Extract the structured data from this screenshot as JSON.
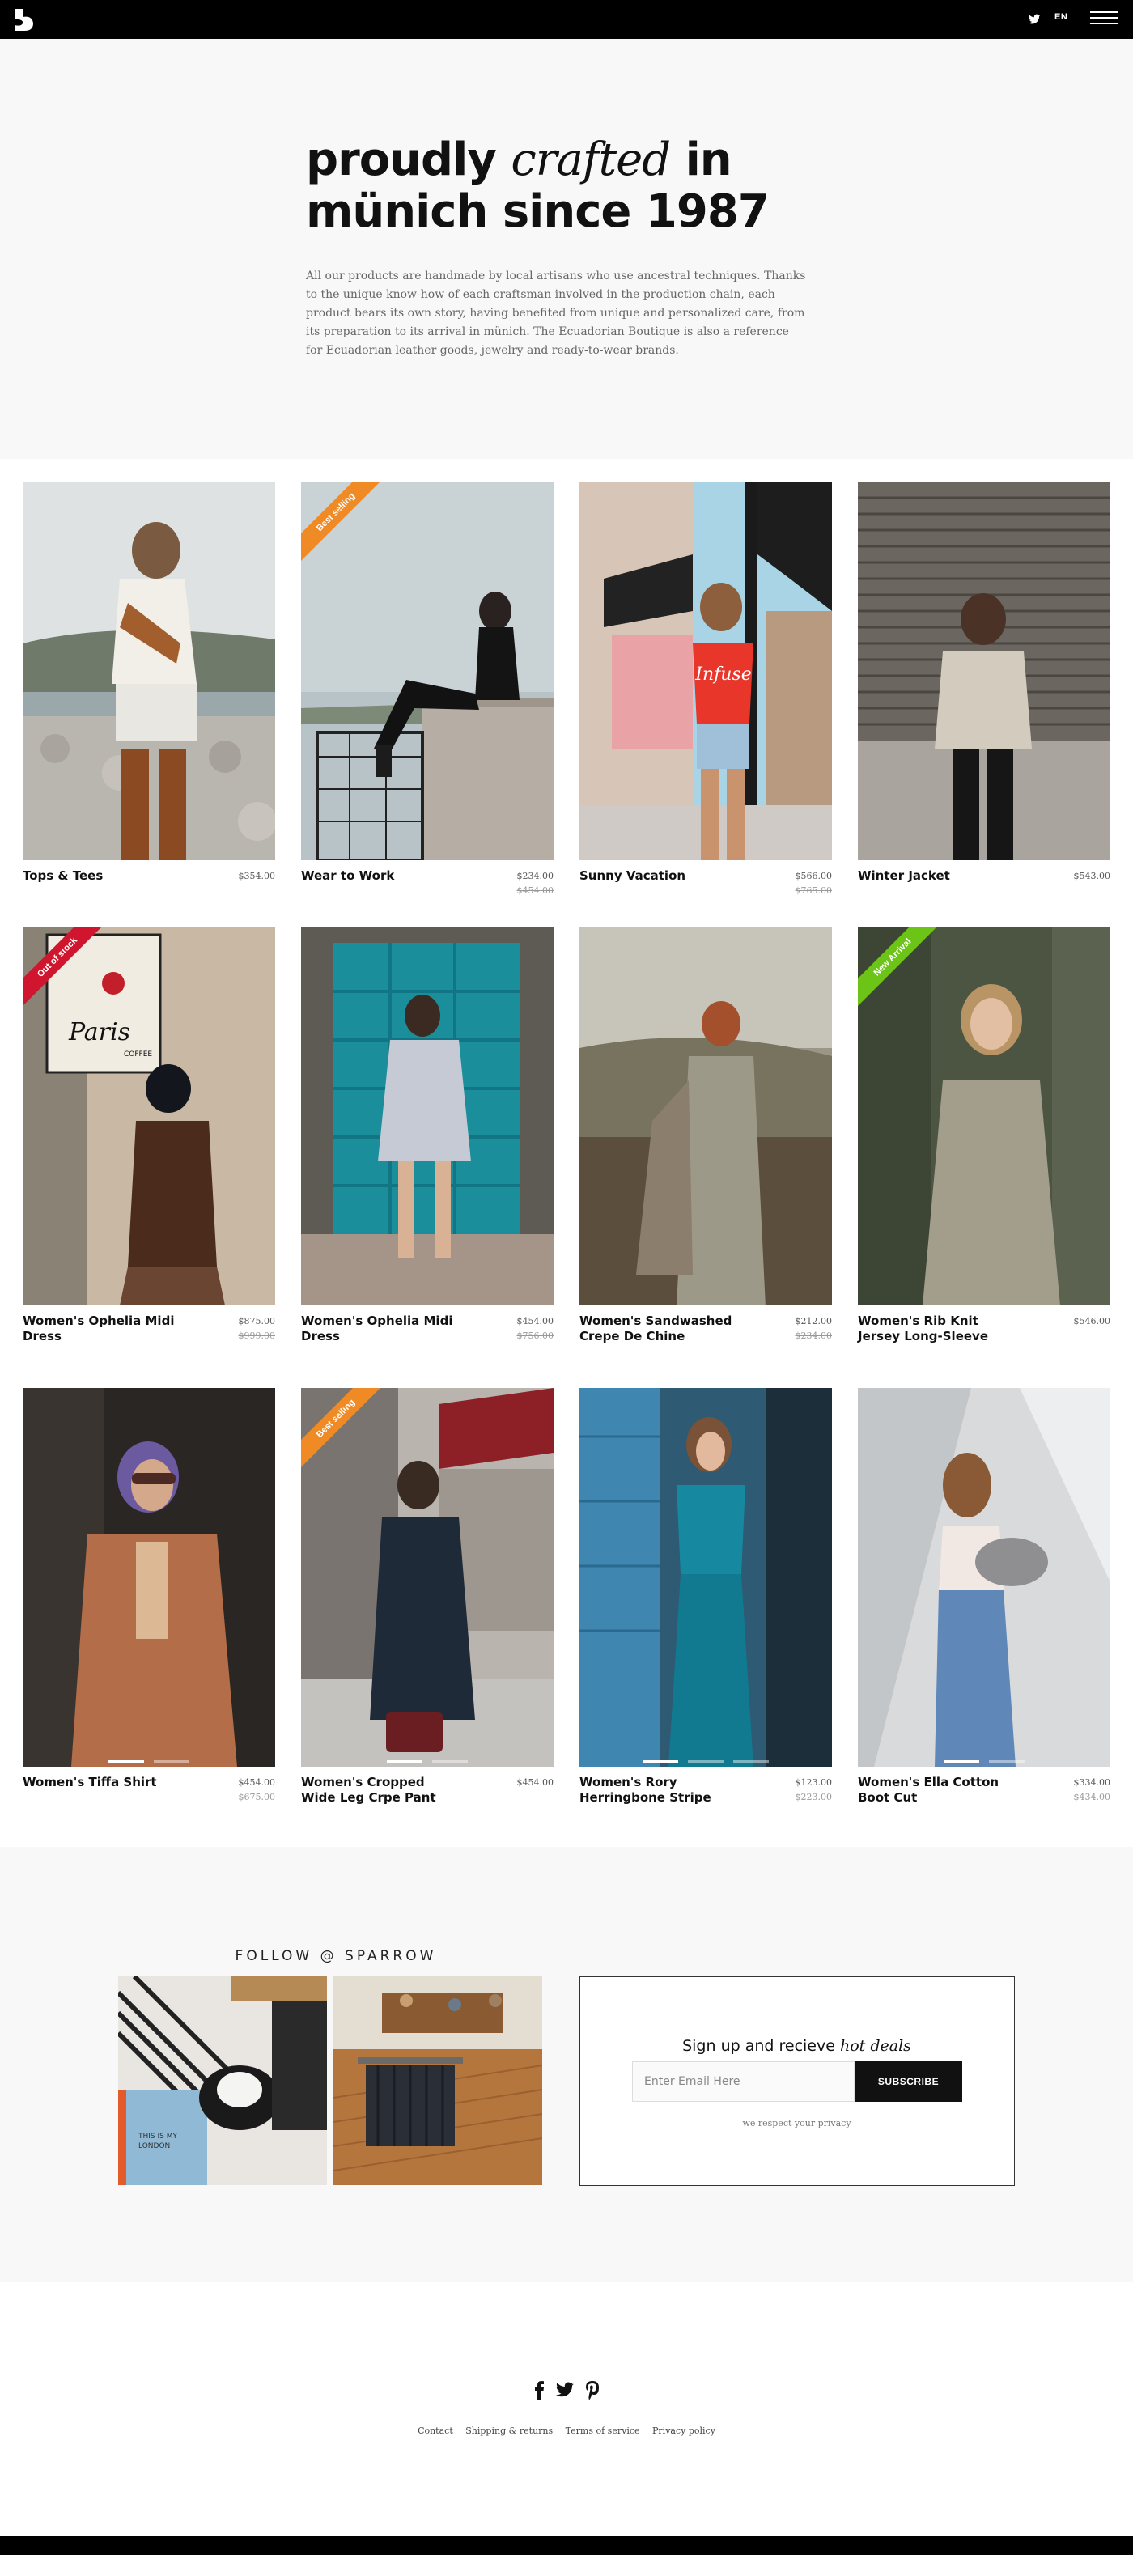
{
  "header": {
    "logo_icon": "sparrow-logo-icon",
    "twitter_icon": "twitter-icon",
    "language": "EN",
    "menu_icon": "hamburger-menu-icon"
  },
  "hero": {
    "title_part1": "proudly",
    "title_italic": "crafted",
    "title_part2": "in",
    "title_line2": "münich since 1987",
    "description": "All our products are handmade by local artisans who use ancestral techniques. Thanks to the unique know-how of each craftsman involved in the production chain, each product bears its own story, having benefited from unique and personalized care, from its preparation to its arrival in münich. The Ecuadorian Boutique is also a reference for Ecuadorian leather goods, jewelry and ready-to-wear brands."
  },
  "products": [
    {
      "name": "Tops & Tees",
      "price": "$354.00",
      "old_price": ""
    },
    {
      "name": "Wear to Work",
      "price": "$234.00",
      "old_price": "$454.00",
      "badge": "Best selling"
    },
    {
      "name": "Sunny Vacation",
      "price": "$566.00",
      "old_price": "$765.00"
    },
    {
      "name": "Winter Jacket",
      "price": "$543.00",
      "old_price": ""
    },
    {
      "name": "Women's Ophelia Midi Dress",
      "price": "$875.00",
      "old_price": "$999.00",
      "badge": "Out of stock"
    },
    {
      "name": "Women's Ophelia Midi Dress",
      "price": "$454.00",
      "old_price": "$756.00"
    },
    {
      "name": "Women's Sandwashed Crepe De Chine",
      "price": "$212.00",
      "old_price": "$234.00"
    },
    {
      "name": "Women's Rib Knit Jersey Long-Sleeve",
      "price": "$546.00",
      "old_price": "",
      "badge": "New Arrival"
    },
    {
      "name": "Women's Tiffa Shirt",
      "price": "$454.00",
      "old_price": "$675.00"
    },
    {
      "name": "Women's Cropped Wide Leg Crpe Pant",
      "price": "$454.00",
      "old_price": "",
      "badge": "Best selling"
    },
    {
      "name": "Women's Rory Herringbone Stripe",
      "price": "$123.00",
      "old_price": "$223.00"
    },
    {
      "name": "Women's Ella Cotton Boot Cut",
      "price": "$334.00",
      "old_price": "$434.00"
    }
  ],
  "badge_colors": {
    "Best selling": "#f08a24",
    "Out of stock": "#d0152f",
    "New Arrival": "#6cc417"
  },
  "follow": {
    "title": "FOLLOW @ SPARROW"
  },
  "signup": {
    "title_plain": "Sign up and recieve",
    "title_italic": "hot deals",
    "email_placeholder": "Enter Email Here",
    "button": "SUBSCRIBE",
    "privacy": "we respect your privacy"
  },
  "footer": {
    "social_icons": [
      "facebook-icon",
      "twitter-icon",
      "pinterest-icon"
    ],
    "links": [
      "Contact",
      "Shipping & returns",
      "Terms of service",
      "Privacy policy"
    ]
  }
}
